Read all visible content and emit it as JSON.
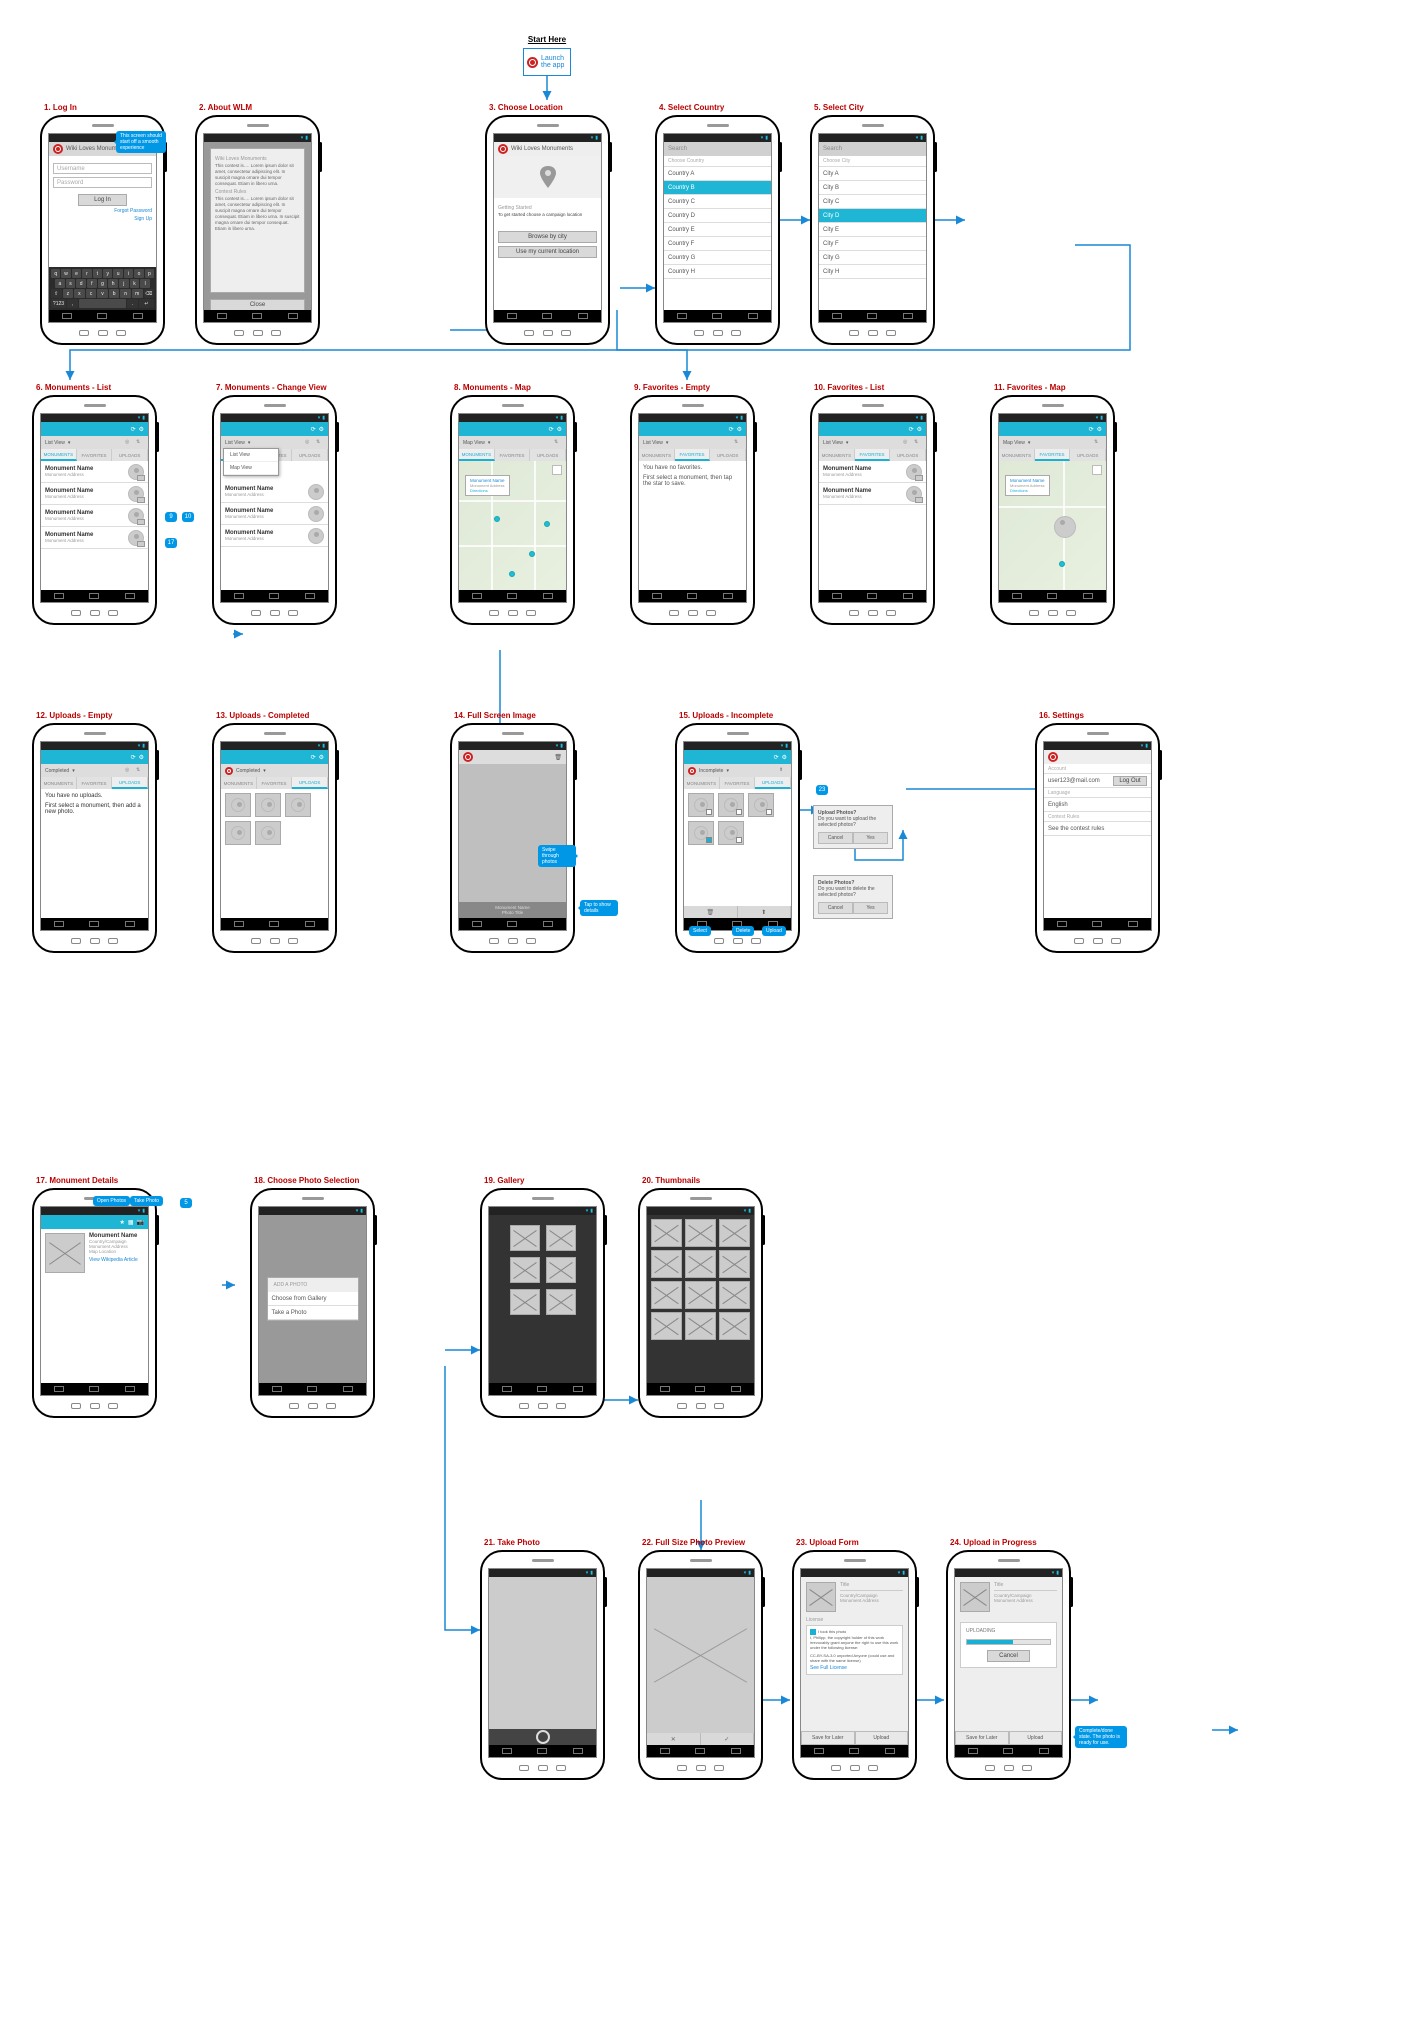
{
  "start": {
    "label": "Start Here",
    "action": "Launch the app"
  },
  "screens": {
    "s1": "1. Log In",
    "s2": "2. About WLM",
    "s3": "3. Choose Location",
    "s4": "4. Select Country",
    "s5": "5. Select City",
    "s6": "6. Monuments - List",
    "s7": "7. Monuments - Change View",
    "s8": "8. Monuments - Map",
    "s9": "9. Favorites - Empty",
    "s10": "10. Favorites - List",
    "s11": "11. Favorites - Map",
    "s12": "12. Uploads - Empty",
    "s13": "13. Uploads - Completed",
    "s14": "14. Full Screen Image",
    "s15": "15. Uploads - Incomplete",
    "s16": "16. Settings",
    "s17": "17. Monument Details",
    "s18": "18. Choose Photo Selection",
    "s19": "19. Gallery",
    "s20": "20. Thumbnails",
    "s21": "21. Take Photo",
    "s22": "22. Full Size Photo Preview",
    "s23": "23. Upload Form",
    "s24": "24. Upload in Progress"
  },
  "app_title": "Wiki Loves Monuments",
  "hints": {
    "login_top": "This screen should start off a smooth experience",
    "fullscreen_1": "Swipe through photos",
    "fullscreen_2": "Tap to show details",
    "upload_done": "Complete/done state. The photo is ready for use."
  },
  "login": {
    "username_ph": "Username",
    "password_ph": "Password",
    "login_btn": "Log In",
    "forgot": "Forgot Password",
    "signup": "Sign Up"
  },
  "about": {
    "header": "Wiki Loves Monuments",
    "rules": "Contest Rules",
    "lorem": "This contest is…. Lorem ipsum dolor sit amet, consectetur adipiscing elit. In suscipit magna ornare dui tempor consequat. Etiam in libero urna.",
    "lorem2": "This contest is…. Lorem ipsum dolor sit amet, consectetur adipiscing elit. In suscipit magna ornare dui tempor consequat. Etiam in libero urna. In suscipit magna ornare dui tempor consequat. Etiam in libero urna.",
    "close": "Close"
  },
  "choose": {
    "getting_started": "Getting Started",
    "body": "To get started choose a campaign location",
    "browse": "Browse by city",
    "current": "Use my current location"
  },
  "select_country": {
    "search": "Search",
    "header": "Choose Country",
    "items": [
      "Country A",
      "Country B",
      "Country C",
      "Country D",
      "Country E",
      "Country F",
      "Country G",
      "Country H"
    ],
    "selected": 1
  },
  "select_city": {
    "search": "Search",
    "header": "Choose City",
    "items": [
      "City A",
      "City B",
      "City C",
      "City D",
      "City E",
      "City F",
      "City G",
      "City H"
    ],
    "selected": 3
  },
  "list_common": {
    "list_view": "List View",
    "map_view": "Map View",
    "completed": "Completed",
    "incomplete": "Incomplete",
    "tabs": [
      "MONUMENTS",
      "FAVORITES",
      "UPLOADS"
    ],
    "mon_name": "Monument Name",
    "mon_addr": "Monument Address",
    "directions": "Directions"
  },
  "fav_empty": {
    "l1": "You have no favorites.",
    "l2": "First select a monument, then tap the star to save."
  },
  "up_empty": {
    "l1": "You have no uploads.",
    "l2": "First select a monument, then add a new photo."
  },
  "fullscreen": {
    "name": "Monument Name",
    "sub": "Photo Title"
  },
  "incomplete": {
    "upload_all": "Upload All",
    "delete": "Delete",
    "select": "Select",
    "upload": "Upload",
    "d1_title": "Upload Photos?",
    "d1_body": "Do you want to upload the selected photos?",
    "d2_title": "Delete Photos?",
    "d2_body": "Do you want to delete the selected photos?",
    "cancel": "Cancel",
    "yes": "Yes"
  },
  "settings": {
    "account": "Account",
    "email": "user123@mail.com",
    "logout": "Log Out",
    "language": "Language",
    "english": "English",
    "rules": "Contest Rules",
    "see_rules": "See the contest rules"
  },
  "details": {
    "name": "Monument Name",
    "meta": "Country/Campaign\nMonument Address\nMap Location",
    "wiki": "View Wikipedia Article",
    "h1": "Open Photos",
    "h2": "Take Photo"
  },
  "photo_select": {
    "header": "ADD A PHOTO",
    "opt1": "Choose from Gallery",
    "opt2": "Take a Photo"
  },
  "preview": {
    "cancel": "✕",
    "ok": "✓"
  },
  "form": {
    "title": "Title",
    "meta": "Country/Campaign\nMonument Address",
    "license_h": "License",
    "chk": "I took this photo",
    "line1": "I, Philipp, the copyright holder of this work irrevocably grant anyone the right to use this work under the following license:",
    "line2": "CC-BY-SA-3.0 unported Anyone (could use and share with the same license)",
    "line3": "See Full License",
    "save": "Save for Later",
    "upload": "Upload"
  },
  "progress": {
    "uploading": "UPLOADING",
    "cancel": "Cancel"
  },
  "nums": {
    "a": "9",
    "b": "10",
    "c": "17",
    "d": "23",
    "e": "5"
  }
}
